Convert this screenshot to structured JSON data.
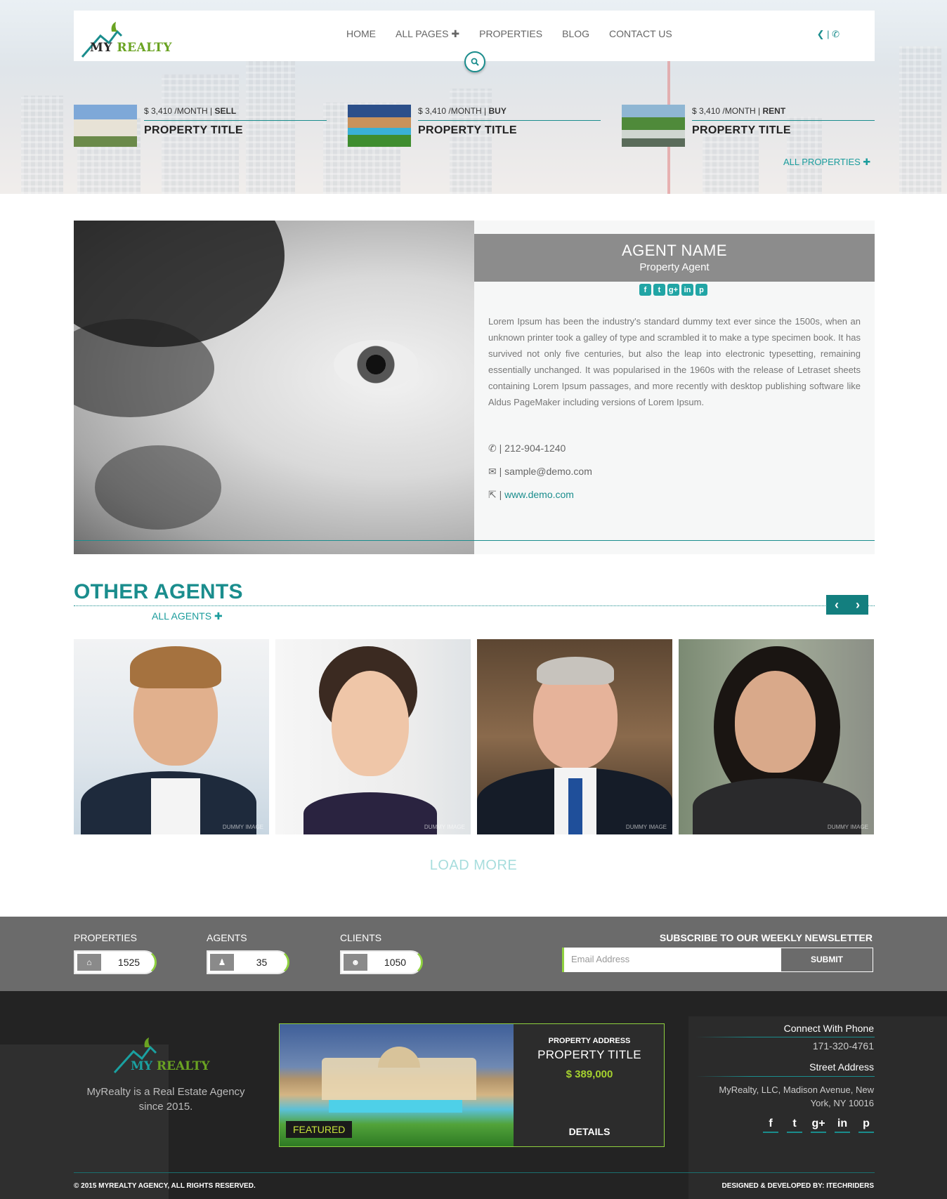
{
  "header": {
    "logo_text_a": "MY ",
    "logo_text_b": "REALTY",
    "nav": [
      "HOME",
      "ALL PAGES",
      "PROPERTIES",
      "BLOG",
      "CONTACT US"
    ],
    "nav_plus": "✚",
    "contact_icons": "❮ | ✆",
    "search_icon": "search-icon"
  },
  "featured_strip": [
    {
      "price": "$ 3,410 /MONTH | ",
      "type": "SELL",
      "title": "PROPERTY TITLE"
    },
    {
      "price": "$ 3,410 /MONTH | ",
      "type": "BUY",
      "title": "PROPERTY TITLE"
    },
    {
      "price": "$ 3,410 /MONTH | ",
      "type": "RENT",
      "title": "PROPERTY TITLE"
    }
  ],
  "all_properties": "ALL PROPERTIES ✚",
  "agent": {
    "name": "AGENT NAME",
    "role": "Property Agent",
    "social": [
      "f",
      "t",
      "g+",
      "in",
      "p"
    ],
    "bio": "Lorem Ipsum has been the industry's standard dummy text ever since the 1500s, when an unknown printer took a galley of type and scrambled it to make a type specimen book. It has survived not only five centuries, but also the leap into electronic typesetting, remaining essentially unchanged. It was popularised in the 1960s with the release of Letraset sheets containing Lorem Ipsum passages, and more recently with desktop publishing software like Aldus PageMaker including versions of Lorem Ipsum.",
    "phone": "| 212-904-1240",
    "email": "| sample@demo.com",
    "website": "www.demo.com"
  },
  "other_agents": {
    "title": "OTHER AGENTS",
    "all_link": "ALL AGENTS ✚",
    "prev": "‹",
    "next": "›",
    "watermark": "DUMMY IMAGE",
    "load_more": "LOAD MORE"
  },
  "stats": [
    {
      "label": "PROPERTIES",
      "value": "1525",
      "icon": "home-icon"
    },
    {
      "label": "AGENTS",
      "value": "35",
      "icon": "user-icon"
    },
    {
      "label": "CLIENTS",
      "value": "1050",
      "icon": "users-icon"
    }
  ],
  "newsletter": {
    "title": "SUBSCRIBE TO OUR WEEKLY NEWSLETTER",
    "placeholder": "Email Address",
    "submit": "SUBMIT"
  },
  "footer": {
    "logo_a": "MY ",
    "logo_b": "REALTY",
    "tagline": "MyRealty is a Real Estate Agency since 2015.",
    "featured": {
      "tag": "FEATURED",
      "address": "PROPERTY ADDRESS",
      "title": "PROPERTY TITLE",
      "price": "$ 389,000",
      "details": "DETAILS"
    },
    "phone_label": "Connect With Phone",
    "phone": "171-320-4761",
    "address_label": "Street Address",
    "address": "MyRealty, LLC, Madison Avenue, New York, NY 10016",
    "social": [
      "f",
      "t",
      "g+",
      "in",
      "p"
    ],
    "copyright": "© 2015 MYREALTY AGENCY, ALL RIGHTS RESERVED.",
    "credit": "DESIGNED & DEVELOPED BY: ITECHRIDERS"
  },
  "colors": {
    "accent": "#1a8d8d",
    "lime": "#8fd13f",
    "stats_bg": "#6b6b6b",
    "footer_bg": "#232323"
  }
}
